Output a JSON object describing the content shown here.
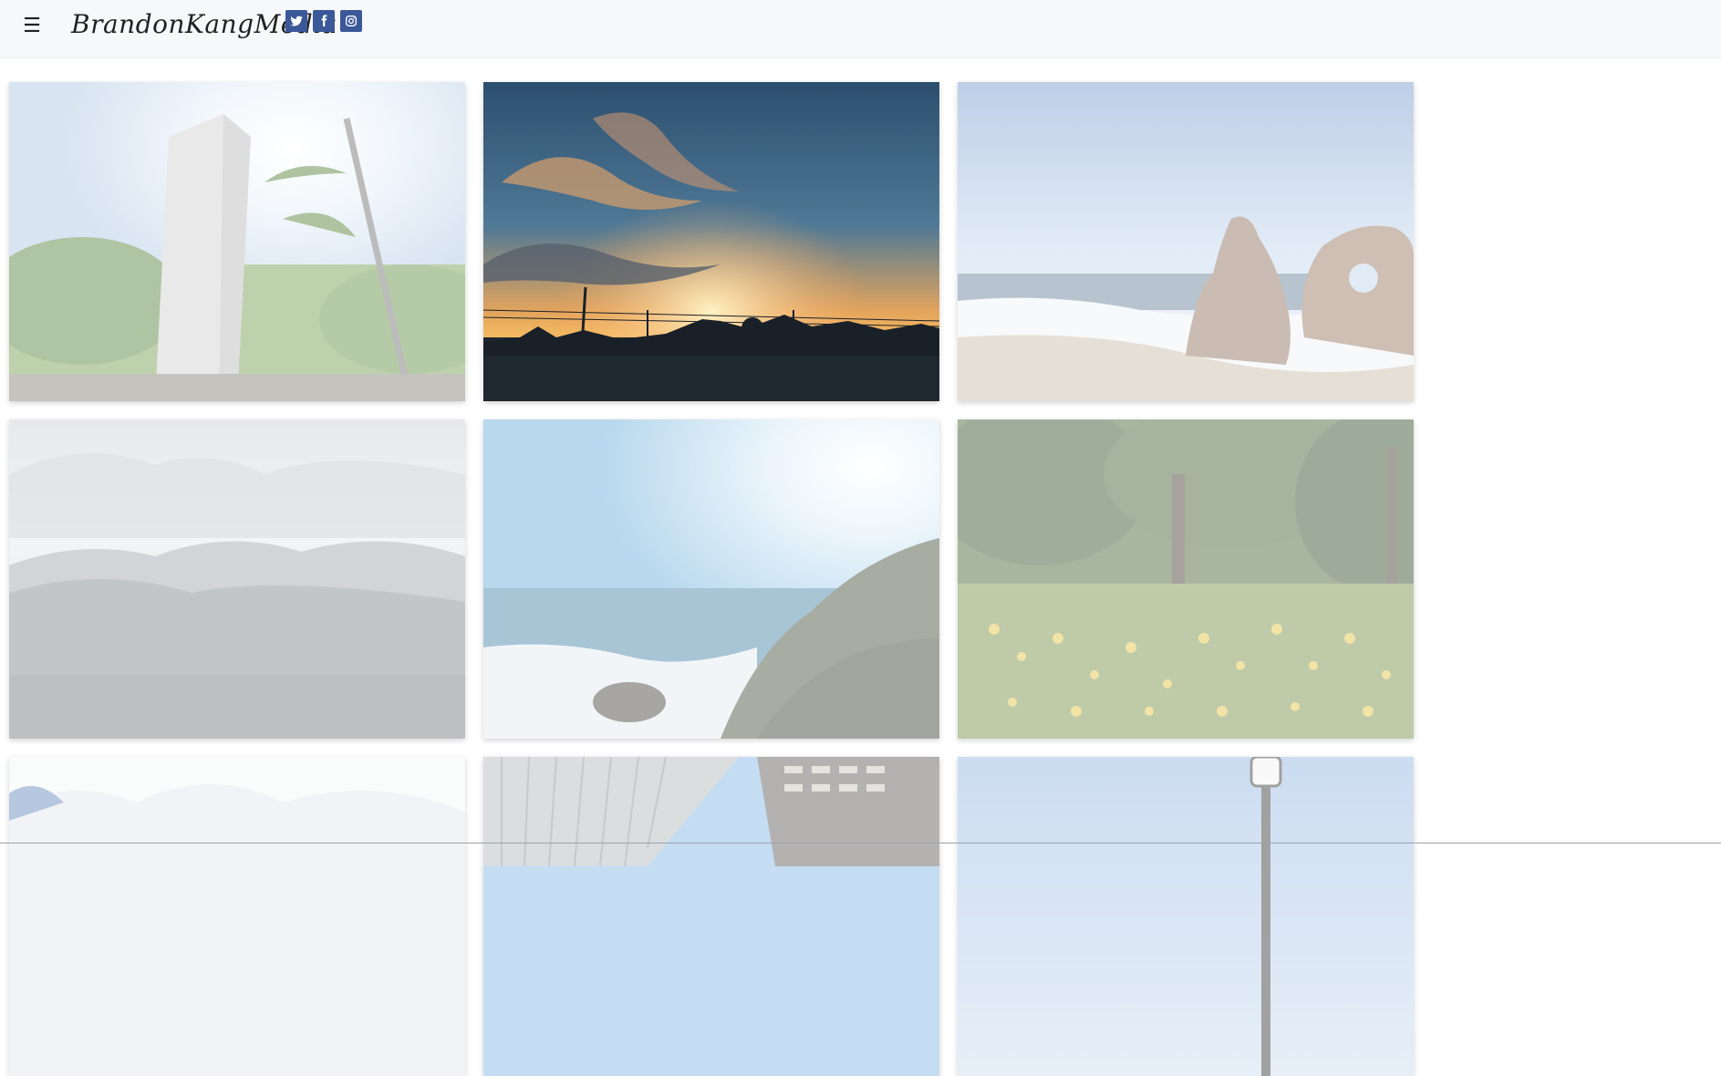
{
  "header": {
    "menu_icon": "hamburger-icon",
    "menu_glyph": "☰",
    "brand_text": "BrandonKangMedia",
    "social": [
      {
        "name": "twitter",
        "icon": "twitter-icon",
        "color": "#3b5998"
      },
      {
        "name": "facebook",
        "icon": "facebook-icon",
        "color": "#3b5998"
      },
      {
        "name": "instagram",
        "icon": "instagram-icon",
        "color": "#3b5998"
      }
    ]
  },
  "gallery": {
    "photos": [
      {
        "subject": "tower with palm trees and bright sun",
        "faded": true
      },
      {
        "subject": "sunset city skyline silhouette",
        "faded": false
      },
      {
        "subject": "beach with sea rocks",
        "faded": true
      },
      {
        "subject": "misty mountain range",
        "faded": true
      },
      {
        "subject": "ocean coastline cliffs",
        "faded": true
      },
      {
        "subject": "forest meadow with yellow flowers",
        "faded": true
      },
      {
        "subject": "cloudy sky",
        "faded": true
      },
      {
        "subject": "skyscrapers looking up",
        "faded": true
      },
      {
        "subject": "street lamp against sky",
        "faded": true
      }
    ]
  },
  "colors": {
    "header_bg": "#f7f8fa",
    "social_bg": "#3b5998"
  }
}
